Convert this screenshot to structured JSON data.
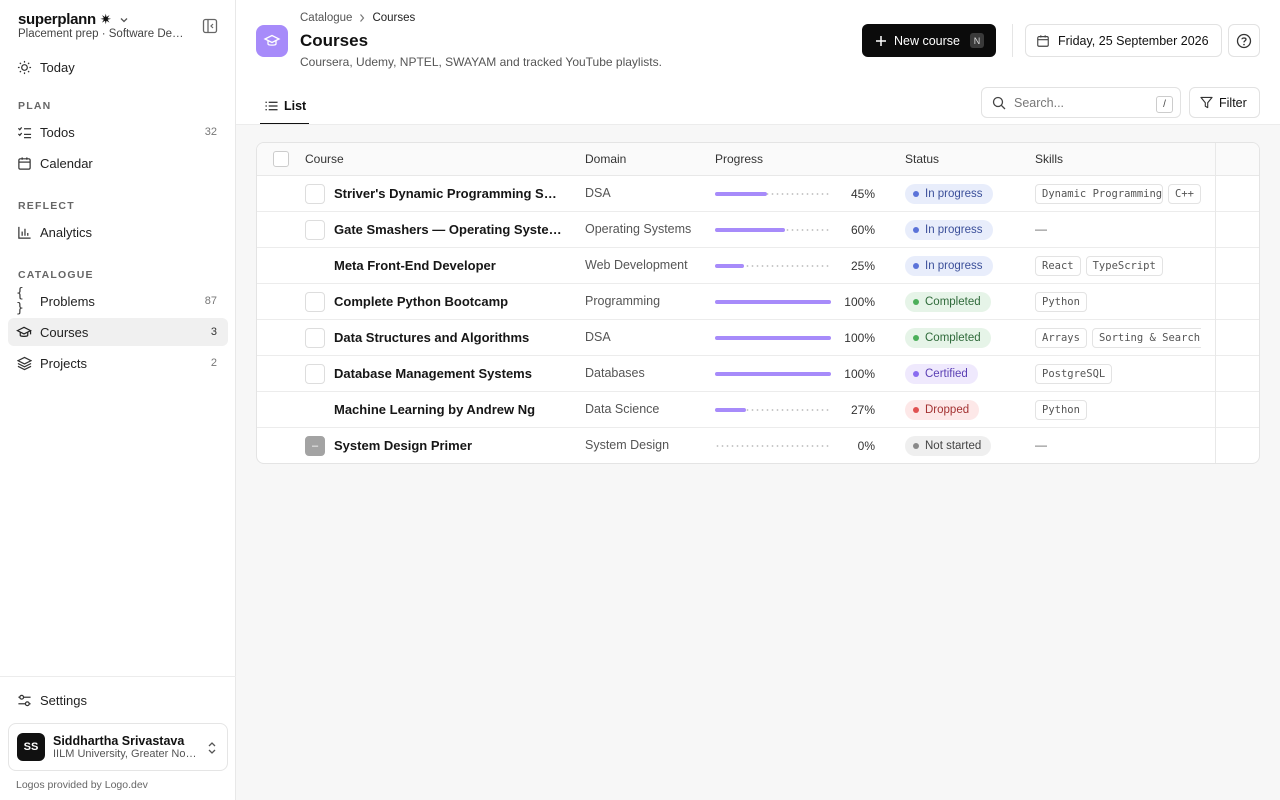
{
  "app": {
    "brand": "superplann",
    "brand_mark": "✷",
    "workspace": "Placement prep · Software Development"
  },
  "sidebar": {
    "today": "Today",
    "sections": {
      "plan": "PLAN",
      "reflect": "REFLECT",
      "catalogue": "CATALOGUE"
    },
    "items": {
      "todos": {
        "label": "Todos",
        "count": "32"
      },
      "calendar": {
        "label": "Calendar"
      },
      "analytics": {
        "label": "Analytics"
      },
      "problems": {
        "label": "Problems",
        "count": "87"
      },
      "courses": {
        "label": "Courses",
        "count": "3"
      },
      "projects": {
        "label": "Projects",
        "count": "2"
      }
    },
    "settings": "Settings",
    "user": {
      "initials": "SS",
      "name": "Siddhartha Srivastava",
      "org": "IILM University, Greater Noida"
    },
    "logos_note": "Logos provided by Logo.dev"
  },
  "header": {
    "breadcrumb": [
      "Catalogue",
      "Courses"
    ],
    "title": "Courses",
    "subtitle": "Coursera, Udemy, NPTEL, SWAYAM and tracked YouTube playlists.",
    "new_button": "New course",
    "new_shortcut": "N",
    "date": "Friday, 25 September 2026"
  },
  "toolbar": {
    "tab_list": "List",
    "search_placeholder": "Search...",
    "search_shortcut": "/",
    "filter": "Filter"
  },
  "table": {
    "columns": [
      "Course",
      "Domain",
      "Progress",
      "Status",
      "Skills"
    ],
    "rows": [
      {
        "name": "Striver's Dynamic Programming Series",
        "domain": "DSA",
        "progress": 45,
        "progress_label": "45%",
        "status": "In progress",
        "skills": [
          "Dynamic Programming",
          "C++"
        ]
      },
      {
        "name": "Gate Smashers — Operating Systems",
        "domain": "Operating Systems",
        "progress": 60,
        "progress_label": "60%",
        "status": "In progress",
        "skills": []
      },
      {
        "name": "Meta Front-End Developer",
        "domain": "Web Development",
        "progress": 25,
        "progress_label": "25%",
        "status": "In progress",
        "skills": [
          "React",
          "TypeScript"
        ]
      },
      {
        "name": "Complete Python Bootcamp",
        "domain": "Programming",
        "progress": 100,
        "progress_label": "100%",
        "status": "Completed",
        "skills": [
          "Python"
        ]
      },
      {
        "name": "Data Structures and Algorithms",
        "domain": "DSA",
        "progress": 100,
        "progress_label": "100%",
        "status": "Completed",
        "skills": [
          "Arrays",
          "Sorting & Searching"
        ]
      },
      {
        "name": "Database Management Systems",
        "domain": "Databases",
        "progress": 100,
        "progress_label": "100%",
        "status": "Certified",
        "skills": [
          "PostgreSQL"
        ]
      },
      {
        "name": "Machine Learning by Andrew Ng",
        "domain": "Data Science",
        "progress": 27,
        "progress_label": "27%",
        "status": "Dropped",
        "skills": [
          "Python"
        ]
      },
      {
        "name": "System Design Primer",
        "domain": "System Design",
        "progress": 0,
        "progress_label": "0%",
        "status": "Not started",
        "skills": []
      }
    ],
    "empty_skills": "—"
  },
  "colors": {
    "accent": "#a78bfa",
    "in_progress": {
      "bg": "#e8edfb",
      "fg": "#3b4f9a",
      "dot": "#5b73d9"
    },
    "completed": {
      "bg": "#e6f4e8",
      "fg": "#2f6a3a",
      "dot": "#4caf5a"
    },
    "certified": {
      "bg": "#efe9fd",
      "fg": "#5b3fb4",
      "dot": "#8a6cf0"
    },
    "dropped": {
      "bg": "#fde8e8",
      "fg": "#a33232",
      "dot": "#e05252"
    },
    "not_started": {
      "bg": "#efefef",
      "fg": "#444444",
      "dot": "#8a8a8a"
    }
  }
}
